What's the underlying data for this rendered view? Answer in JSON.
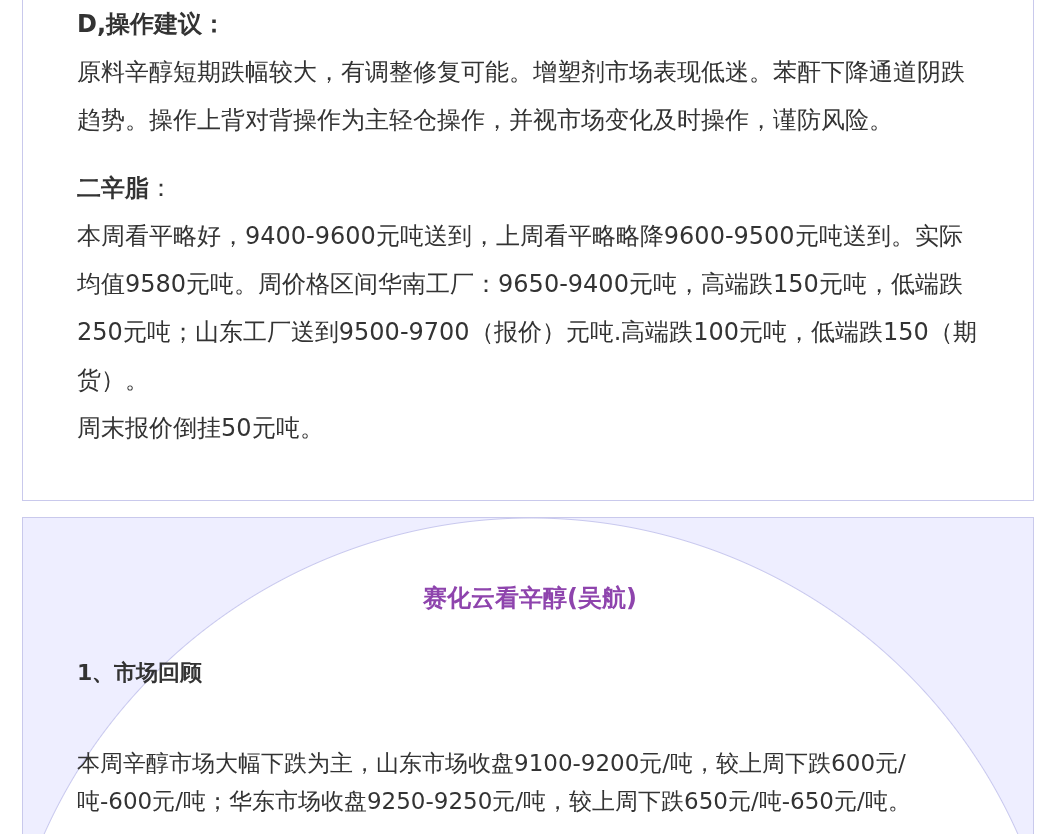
{
  "sections": [
    {
      "kind": "note",
      "blocks": [
        {
          "kind": "heading",
          "text": "D,操作建议："
        },
        {
          "kind": "paragraph",
          "text": "原料辛醇短期跌幅较大，有调整修复可能。增塑剂市场表现低迷。苯酐下降通道阴跌趋势。操作上背对背操作为主轻仓操作，并视市场变化及时操作，谨防风险。"
        },
        {
          "kind": "label",
          "text": "**二辛脂**："
        },
        {
          "kind": "paragraph",
          "text": "本周看平略好，9400-9600元吨送到，上周看平略略降9600-9500元吨送到。实际均值9580元吨。周价格区间华南工厂：9650-9400元吨，高端跌150元吨，低端跌250元吨；山东工厂送到9500-9700（报价）元吨.高端跌100元吨，低端跌150（期货）。"
        },
        {
          "kind": "line",
          "text": "周末报价倒挂50元吨。"
        }
      ]
    },
    {
      "kind": "report",
      "title": "赛化云看辛醇(吴航)",
      "blocks": [
        {
          "kind": "heading",
          "text": "1、市场回顾"
        },
        {
          "kind": "paragraph",
          "text": "本周辛醇市场大幅下跌为主，山东市场收盘9100-9200元/吨，较上周下跌600元/吨-600元/吨；华东市场收盘9250-9250元/吨，较上周下跌650元/吨-650元/吨。"
        }
      ]
    }
  ]
}
